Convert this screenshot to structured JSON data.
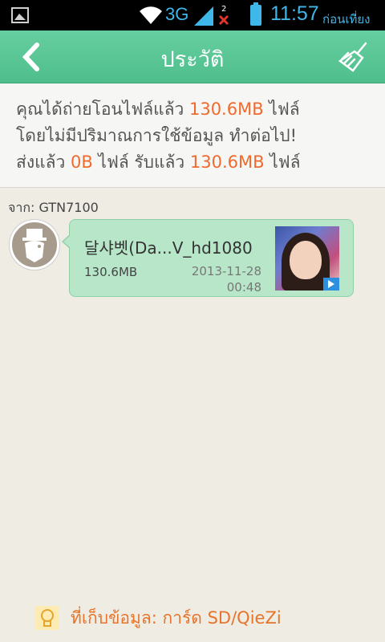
{
  "status_bar": {
    "network": "3G",
    "time": "11:57",
    "ampm": "ก่อนเที่ยง",
    "icons": [
      "gallery-icon",
      "wifi-icon",
      "signal-icon",
      "sim2-missing-icon",
      "battery-icon"
    ]
  },
  "header": {
    "title": "ประวัติ",
    "back_icon": "back-chevron-icon",
    "clean_icon": "broom-icon"
  },
  "summary": {
    "line1_prefix": "คุณได้ถ่ายโอนไฟล์แล้ว ",
    "line1_value": "130.6MB",
    "line1_suffix": " ไฟล์",
    "line2": "โดยไม่มีปริมาณการใช้ข้อมูล ทำต่อไป!",
    "line3_prefix": "ส่งแล้ว ",
    "sent_value": "0B",
    "line3_mid": " ไฟล์ รับแล้ว ",
    "received_value": "130.6MB",
    "line3_suffix": " ไฟล์"
  },
  "history": {
    "from_label": "จาก: GTN7100",
    "items": [
      {
        "name": "달샤벳(Da...V_hd1080",
        "size": "130.6MB",
        "date": "2013-11-28",
        "time": "00:48"
      }
    ]
  },
  "footer": {
    "storage_label": "ที่เก็บข้อมูล: การ์ด SD/QieZi"
  },
  "colors": {
    "header_green": "#5ac796",
    "highlight_orange": "#f06a2d",
    "bubble_green": "#b7e7c8",
    "footer_orange": "#e6752b",
    "status_blue": "#3fb7e8"
  }
}
